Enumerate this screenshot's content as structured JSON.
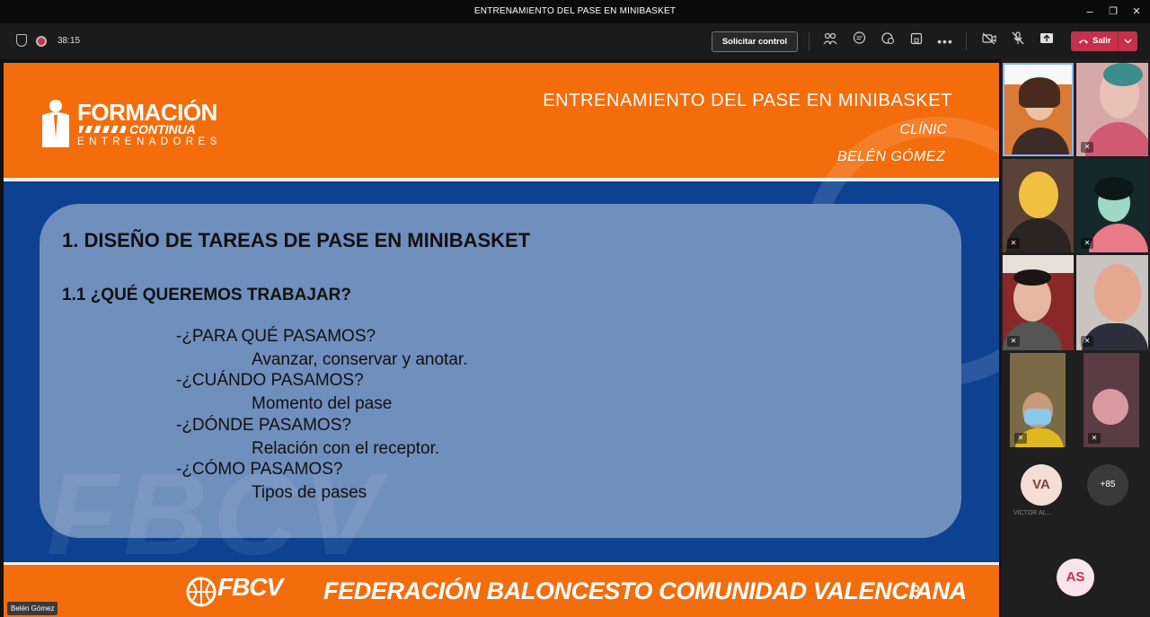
{
  "window": {
    "title": "ENTRENAMIENTO DEL PASE EN MINIBASKET",
    "minimize_glyph": "–",
    "restore_glyph": "❐",
    "close_glyph": "✕"
  },
  "toolbar": {
    "timer": "38:15",
    "request_control_label": "Solicitar control",
    "leave_label": "Salir",
    "icons": [
      "participants-icon",
      "chat-icon",
      "reactions-icon",
      "rooms-icon",
      "more-icon",
      "camera-off-icon",
      "mic-off-icon",
      "share-icon"
    ]
  },
  "slide": {
    "logo_line1": "FORMACIÓN",
    "logo_line2": "CONTINUA",
    "logo_line3": "ENTRENADORES",
    "title": "ENTRENAMIENTO DEL PASE EN MINIBASKET",
    "subtitle1": "CLÍNIC",
    "subtitle2": "BELÉN GÓMEZ",
    "heading1": "1. DISEÑO DE TAREAS DE PASE EN MINIBASKET",
    "heading2": "1.1 ¿QUÉ QUEREMOS TRABAJAR?",
    "items": [
      {
        "question": "-¿PARA QUÉ PASAMOS?",
        "answer": "Avanzar, conservar y anotar."
      },
      {
        "question": "-¿CUÁNDO PASAMOS?",
        "answer": "Momento del pase"
      },
      {
        "question": "-¿DÓNDE PASAMOS?",
        "answer": "Relación con el receptor."
      },
      {
        "question": "-¿CÓMO PASAMOS?",
        "answer": "Tipos de pases"
      }
    ],
    "watermark": "FBCV",
    "footer_logo": "FBCV",
    "footer_text": "FEDERACIÓN BALONCESTO COMUNIDAD VALENCIANA",
    "page_number": "3"
  },
  "presenter_name": "Belén Gómez",
  "participants": {
    "avatar1_initials": "VA",
    "avatar1_name": "VÍCTOR AL...",
    "overflow_count": "+85",
    "avatar2_initials": "AS"
  },
  "colors": {
    "slide_orange": "#f36d0c",
    "slide_blue": "#0e4191",
    "panel_blue": "#6f8fbd",
    "leave_red": "#c4314b"
  }
}
